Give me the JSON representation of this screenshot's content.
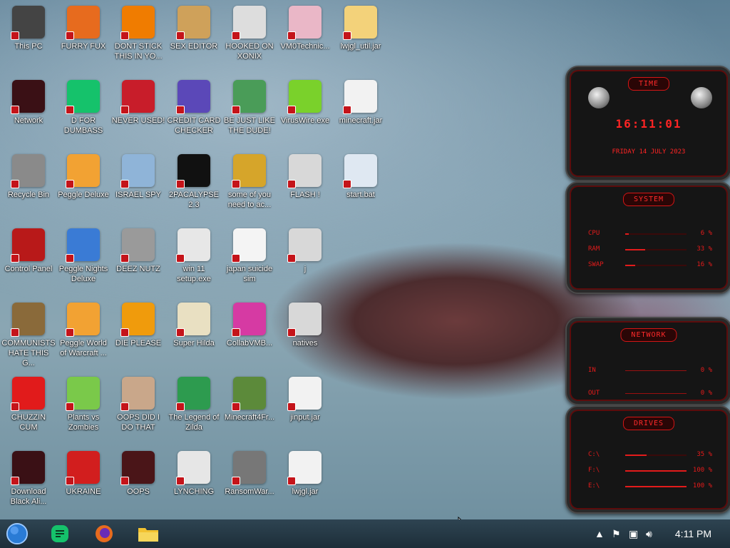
{
  "desktop": {
    "icons": [
      {
        "label": "This PC",
        "color": "#444"
      },
      {
        "label": "FURRY FUX",
        "color": "#e76b1e"
      },
      {
        "label": "DONT STICK THIS IN YO...",
        "color": "#f07c00"
      },
      {
        "label": "SEX EDITOR",
        "color": "#cfa15a"
      },
      {
        "label": "HOOKED ON XONIX",
        "color": "#dddddd"
      },
      {
        "label": "VM0Technic...",
        "color": "#eab7c7"
      },
      {
        "label": "lwjgl_util.jar",
        "color": "#f3d27a"
      },
      {
        "label": "Network",
        "color": "#3a1015"
      },
      {
        "label": "D FOR DUMBASS",
        "color": "#15c26b"
      },
      {
        "label": "NEVER USED!",
        "color": "#c81d2a"
      },
      {
        "label": "CREDIT CARD CHECKER",
        "color": "#5b48b8"
      },
      {
        "label": "BE JUST LIKE THE DUDE!",
        "color": "#4a9c58"
      },
      {
        "label": "VirusWire.exe",
        "color": "#7ad12b"
      },
      {
        "label": "minecraft.jar",
        "color": "#f2f2f2"
      },
      {
        "label": "Recycle Bin",
        "color": "#8a8a8a"
      },
      {
        "label": "Peggle Deluxe",
        "color": "#f2a233"
      },
      {
        "label": "ISRAEL SPY",
        "color": "#8fb4d8"
      },
      {
        "label": "2PACALYPSE 2.3",
        "color": "#111111"
      },
      {
        "label": "some of you need to ac...",
        "color": "#d6a52a"
      },
      {
        "label": "FLASH !",
        "color": "#d8d8d8"
      },
      {
        "label": "start.bat",
        "color": "#dfe8f2"
      },
      {
        "label": "Control Panel",
        "color": "#b81919"
      },
      {
        "label": "Peggle Nights Deluxe",
        "color": "#3a7bd5"
      },
      {
        "label": "DEEZ NUTZ",
        "color": "#9a9a9a"
      },
      {
        "label": "win 11 setup.exe",
        "color": "#e7e7e7"
      },
      {
        "label": "japan suicide sim",
        "color": "#f4f4f4"
      },
      {
        "label": "j",
        "color": "#d8d8d8"
      },
      {
        "label": "COMMUNISTS HATE THIS G...",
        "color": "#8a6a3a"
      },
      {
        "label": "Peggle World of Warcraft ...",
        "color": "#f2a233"
      },
      {
        "label": "DIE PLEASE",
        "color": "#f09b0c"
      },
      {
        "label": "Super Hilda",
        "color": "#e9e0c2"
      },
      {
        "label": "CollabVMB...",
        "color": "#d63aa3"
      },
      {
        "label": "natives",
        "color": "#d8d8d8"
      },
      {
        "label": "CHUZZIN CUM",
        "color": "#e11b1b"
      },
      {
        "label": "Plants vs Zombies",
        "color": "#7ac94a"
      },
      {
        "label": "OOPS DID I DO THAT",
        "color": "#c9a78a"
      },
      {
        "label": "The Legend of Zilda",
        "color": "#2d9b4f"
      },
      {
        "label": "Minecraft4Fr...",
        "color": "#5c8a3a"
      },
      {
        "label": "jinput.jar",
        "color": "#f2f2f2"
      },
      {
        "label": "Download Black Ali...",
        "color": "#3a1015"
      },
      {
        "label": "UKRAINE",
        "color": "#d21e1e"
      },
      {
        "label": "OOPS",
        "color": "#4a1518"
      },
      {
        "label": "LYNCHING",
        "color": "#e6e6e6"
      },
      {
        "label": "RansomWar...",
        "color": "#777777"
      },
      {
        "label": "lwjgl.jar",
        "color": "#f2f2f2"
      }
    ]
  },
  "gadgets": {
    "time": {
      "title": "TIME",
      "clock": "16:11:01",
      "date": "FRIDAY 14 JULY 2023"
    },
    "system": {
      "title": "SYSTEM",
      "rows": [
        {
          "key": "CPU",
          "value": "6 %",
          "fill": 0.06
        },
        {
          "key": "RAM",
          "value": "33 %",
          "fill": 0.33
        },
        {
          "key": "SWAP",
          "value": "16 %",
          "fill": 0.16
        }
      ]
    },
    "network": {
      "title": "NETWORK",
      "rows": [
        {
          "key": "IN",
          "value": "0 %"
        },
        {
          "key": "OUT",
          "value": "0 %"
        }
      ]
    },
    "drives": {
      "title": "DRIVES",
      "rows": [
        {
          "key": "C:\\",
          "value": "35 %",
          "fill": 0.35
        },
        {
          "key": "F:\\",
          "value": "100 %",
          "fill": 1.0
        },
        {
          "key": "E:\\",
          "value": "100 %",
          "fill": 1.0
        }
      ]
    }
  },
  "taskbar": {
    "clock": "4:11 PM",
    "colors": {
      "start": "#2a7bd5",
      "app1": "#15c26b",
      "app2": "#e76b1e",
      "app3": "#f2c230"
    }
  }
}
